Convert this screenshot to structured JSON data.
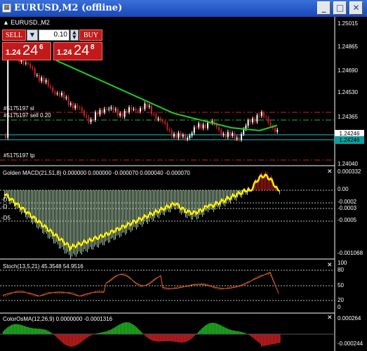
{
  "window": {
    "title": "EURUSD,M2 (offline)",
    "icon": "chart-icon",
    "buttons": {
      "minimize": "_",
      "maximize": "□",
      "close": "✕"
    }
  },
  "chart": {
    "symbol_label": "EURUSD.,M2",
    "price_scale": [
      "1.25015",
      "1.24865",
      "1.24690",
      "1.24530",
      "1.24365",
      "1.24246",
      "1.24040"
    ],
    "current_price": "1.24246",
    "current_price_2": "1.24246",
    "orders": {
      "sl_label": "#5175197 sl",
      "sell_label": "#5175197 sell 0.20",
      "tp_label": "#5175197 tp"
    }
  },
  "trade_panel": {
    "sell_label": "SELL",
    "buy_label": "BUY",
    "lot_value": "0.10",
    "sell_price_small": "1.24",
    "sell_price_big": "24",
    "sell_price_sup": "6",
    "buy_price_small": "1.24",
    "buy_price_big": "24",
    "buy_price_sup": "8"
  },
  "macd": {
    "title": "Golden MACD(21,51,8) 0.000000 0.000000 -0.000070 0.000040 -0.000070",
    "scale": [
      "0.000332",
      "0.00",
      "-0.0002",
      "-0.0003",
      "-0.0005",
      "-0.001068"
    ],
    "left_labels": [
      "-D",
      "-D",
      "-D5"
    ]
  },
  "stoch": {
    "title": "Stoch(13,5,21) 45.3548 54.9516",
    "scale": [
      "100",
      "80",
      "50",
      "20",
      "0"
    ]
  },
  "osma": {
    "title": "ColorOsMA(12,26,9) 0.0000000 -0.0001316",
    "scale": [
      "0.000264",
      "-0.000244"
    ]
  },
  "colors": {
    "candle_up": "#ffffff",
    "candle_down": "#c82020",
    "ma_line": "#22cc22",
    "macd_yellow": "#ffee00",
    "stoch_orange": "#e08020",
    "osma_green": "#22bb22",
    "osma_red": "#cc2020",
    "sl_line": "#cc2020",
    "sell_line": "#22bb22",
    "current_line": "#20c0c0"
  }
}
